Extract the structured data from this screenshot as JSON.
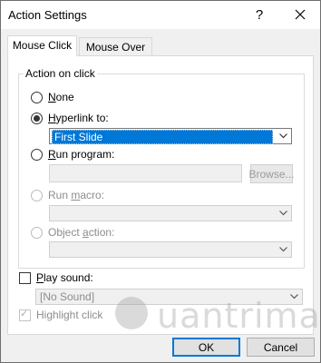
{
  "window": {
    "title": "Action Settings",
    "help_glyph": "?",
    "close_glyph": "✕"
  },
  "tabs": [
    {
      "label": "Mouse Click",
      "active": true
    },
    {
      "label": "Mouse Over",
      "active": false
    }
  ],
  "action_group": {
    "legend": "Action on click",
    "options": {
      "none": {
        "prefix": "",
        "accel": "N",
        "rest": "one",
        "checked": false,
        "enabled": true
      },
      "hyperlink": {
        "prefix": "",
        "accel": "H",
        "rest": "yperlink to:",
        "checked": true,
        "enabled": true
      },
      "run_program": {
        "prefix": "",
        "accel": "R",
        "rest": "un program:",
        "checked": false,
        "enabled": true
      },
      "run_macro": {
        "prefix": "Run ",
        "accel": "m",
        "rest": "acro:",
        "checked": false,
        "enabled": false
      },
      "object_action": {
        "prefix": "Object ",
        "accel": "a",
        "rest": "ction:",
        "checked": false,
        "enabled": false
      }
    },
    "hyperlink_select": {
      "value": "First Slide"
    },
    "program_path": {
      "value": ""
    },
    "browse_button": {
      "label": "Browse..."
    },
    "macro_select": {
      "value": ""
    },
    "object_select": {
      "value": ""
    }
  },
  "sound": {
    "prefix": "",
    "accel": "P",
    "rest": "lay sound:",
    "checked": false,
    "select_value": "[No Sound]"
  },
  "highlight": {
    "label": "Highlight click",
    "checked": true,
    "enabled": false
  },
  "footer": {
    "ok_label": "OK",
    "cancel_label": "Cancel"
  },
  "watermark": {
    "text": "uantrimang"
  },
  "colors": {
    "selection": "#0078d7",
    "background": "#f0f0f0"
  }
}
